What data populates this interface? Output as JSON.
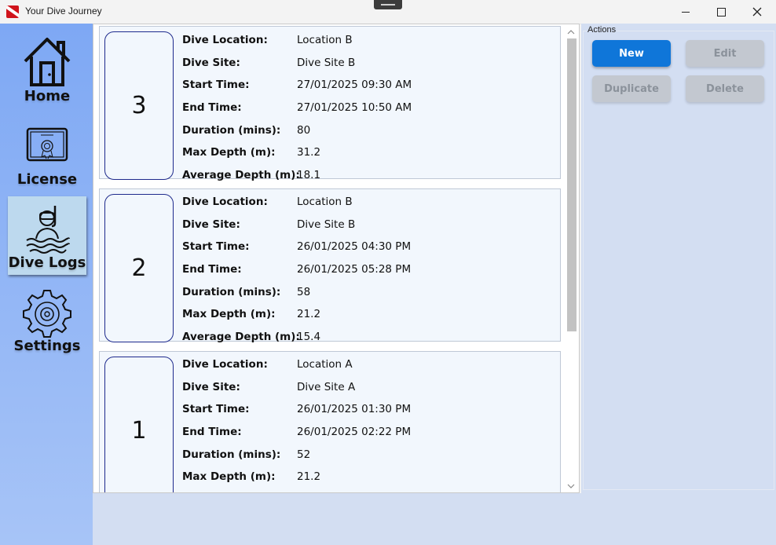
{
  "window": {
    "title": "Your Dive Journey"
  },
  "sidebar": {
    "items": [
      {
        "label": "Home",
        "icon": "home-icon",
        "active": false
      },
      {
        "label": "License",
        "icon": "certificate-icon",
        "active": false
      },
      {
        "label": "Dive Logs",
        "icon": "diver-icon",
        "active": true
      },
      {
        "label": "Settings",
        "icon": "gear-icon",
        "active": false
      }
    ]
  },
  "field_labels": {
    "location": "Dive Location:",
    "site": "Dive Site:",
    "start": "Start Time:",
    "end": "End Time:",
    "duration": "Duration (mins):",
    "max_depth": "Max Depth (m):",
    "avg_depth": "Average Depth (m):"
  },
  "dives": [
    {
      "number": "3",
      "location": "Location B",
      "site": "Dive Site B",
      "start": "27/01/2025 09:30 AM",
      "end": "27/01/2025 10:50 AM",
      "duration": "80",
      "max_depth": "31.2",
      "avg_depth": "18.1"
    },
    {
      "number": "2",
      "location": "Location B",
      "site": "Dive Site B",
      "start": "26/01/2025 04:30 PM",
      "end": "26/01/2025 05:28 PM",
      "duration": "58",
      "max_depth": "21.2",
      "avg_depth": "15.4"
    },
    {
      "number": "1",
      "location": "Location A",
      "site": "Dive Site A",
      "start": "26/01/2025 01:30 PM",
      "end": "26/01/2025 02:22 PM",
      "duration": "52",
      "max_depth": "21.2",
      "avg_depth": ""
    }
  ],
  "actions": {
    "legend": "Actions",
    "new_label": "New",
    "edit_label": "Edit",
    "duplicate_label": "Duplicate",
    "delete_label": "Delete"
  },
  "colors": {
    "primary_button": "#0f76d9",
    "sidebar": "#7ea8f4",
    "active_nav": "#bdd9ee",
    "badge_border": "#1e2a8c"
  }
}
